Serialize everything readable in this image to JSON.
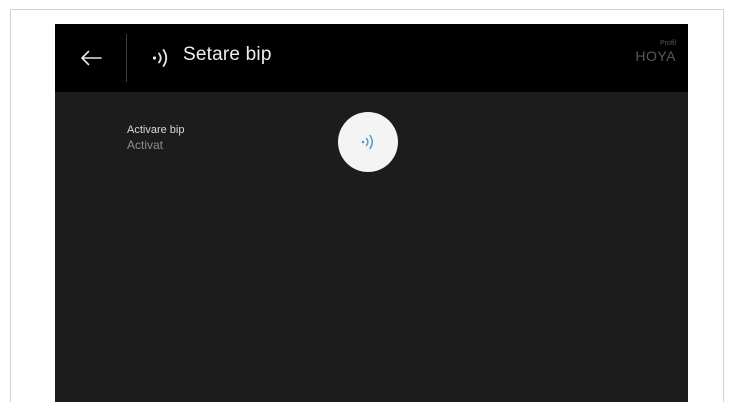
{
  "header": {
    "title": "Setare bip",
    "back_icon": "arrow-left-icon",
    "title_icon": "sound-waves-icon",
    "profile_label": "Profil",
    "profile_name": "HOYA"
  },
  "setting": {
    "label": "Activare bip",
    "value": "Activat",
    "toggle_icon": "sound-waves-icon",
    "toggle_icon_color": "#4a9ec9"
  },
  "colors": {
    "header_bg": "#000000",
    "screen_bg": "#1c1c1c",
    "toggle_bg": "#f4f4f4"
  }
}
